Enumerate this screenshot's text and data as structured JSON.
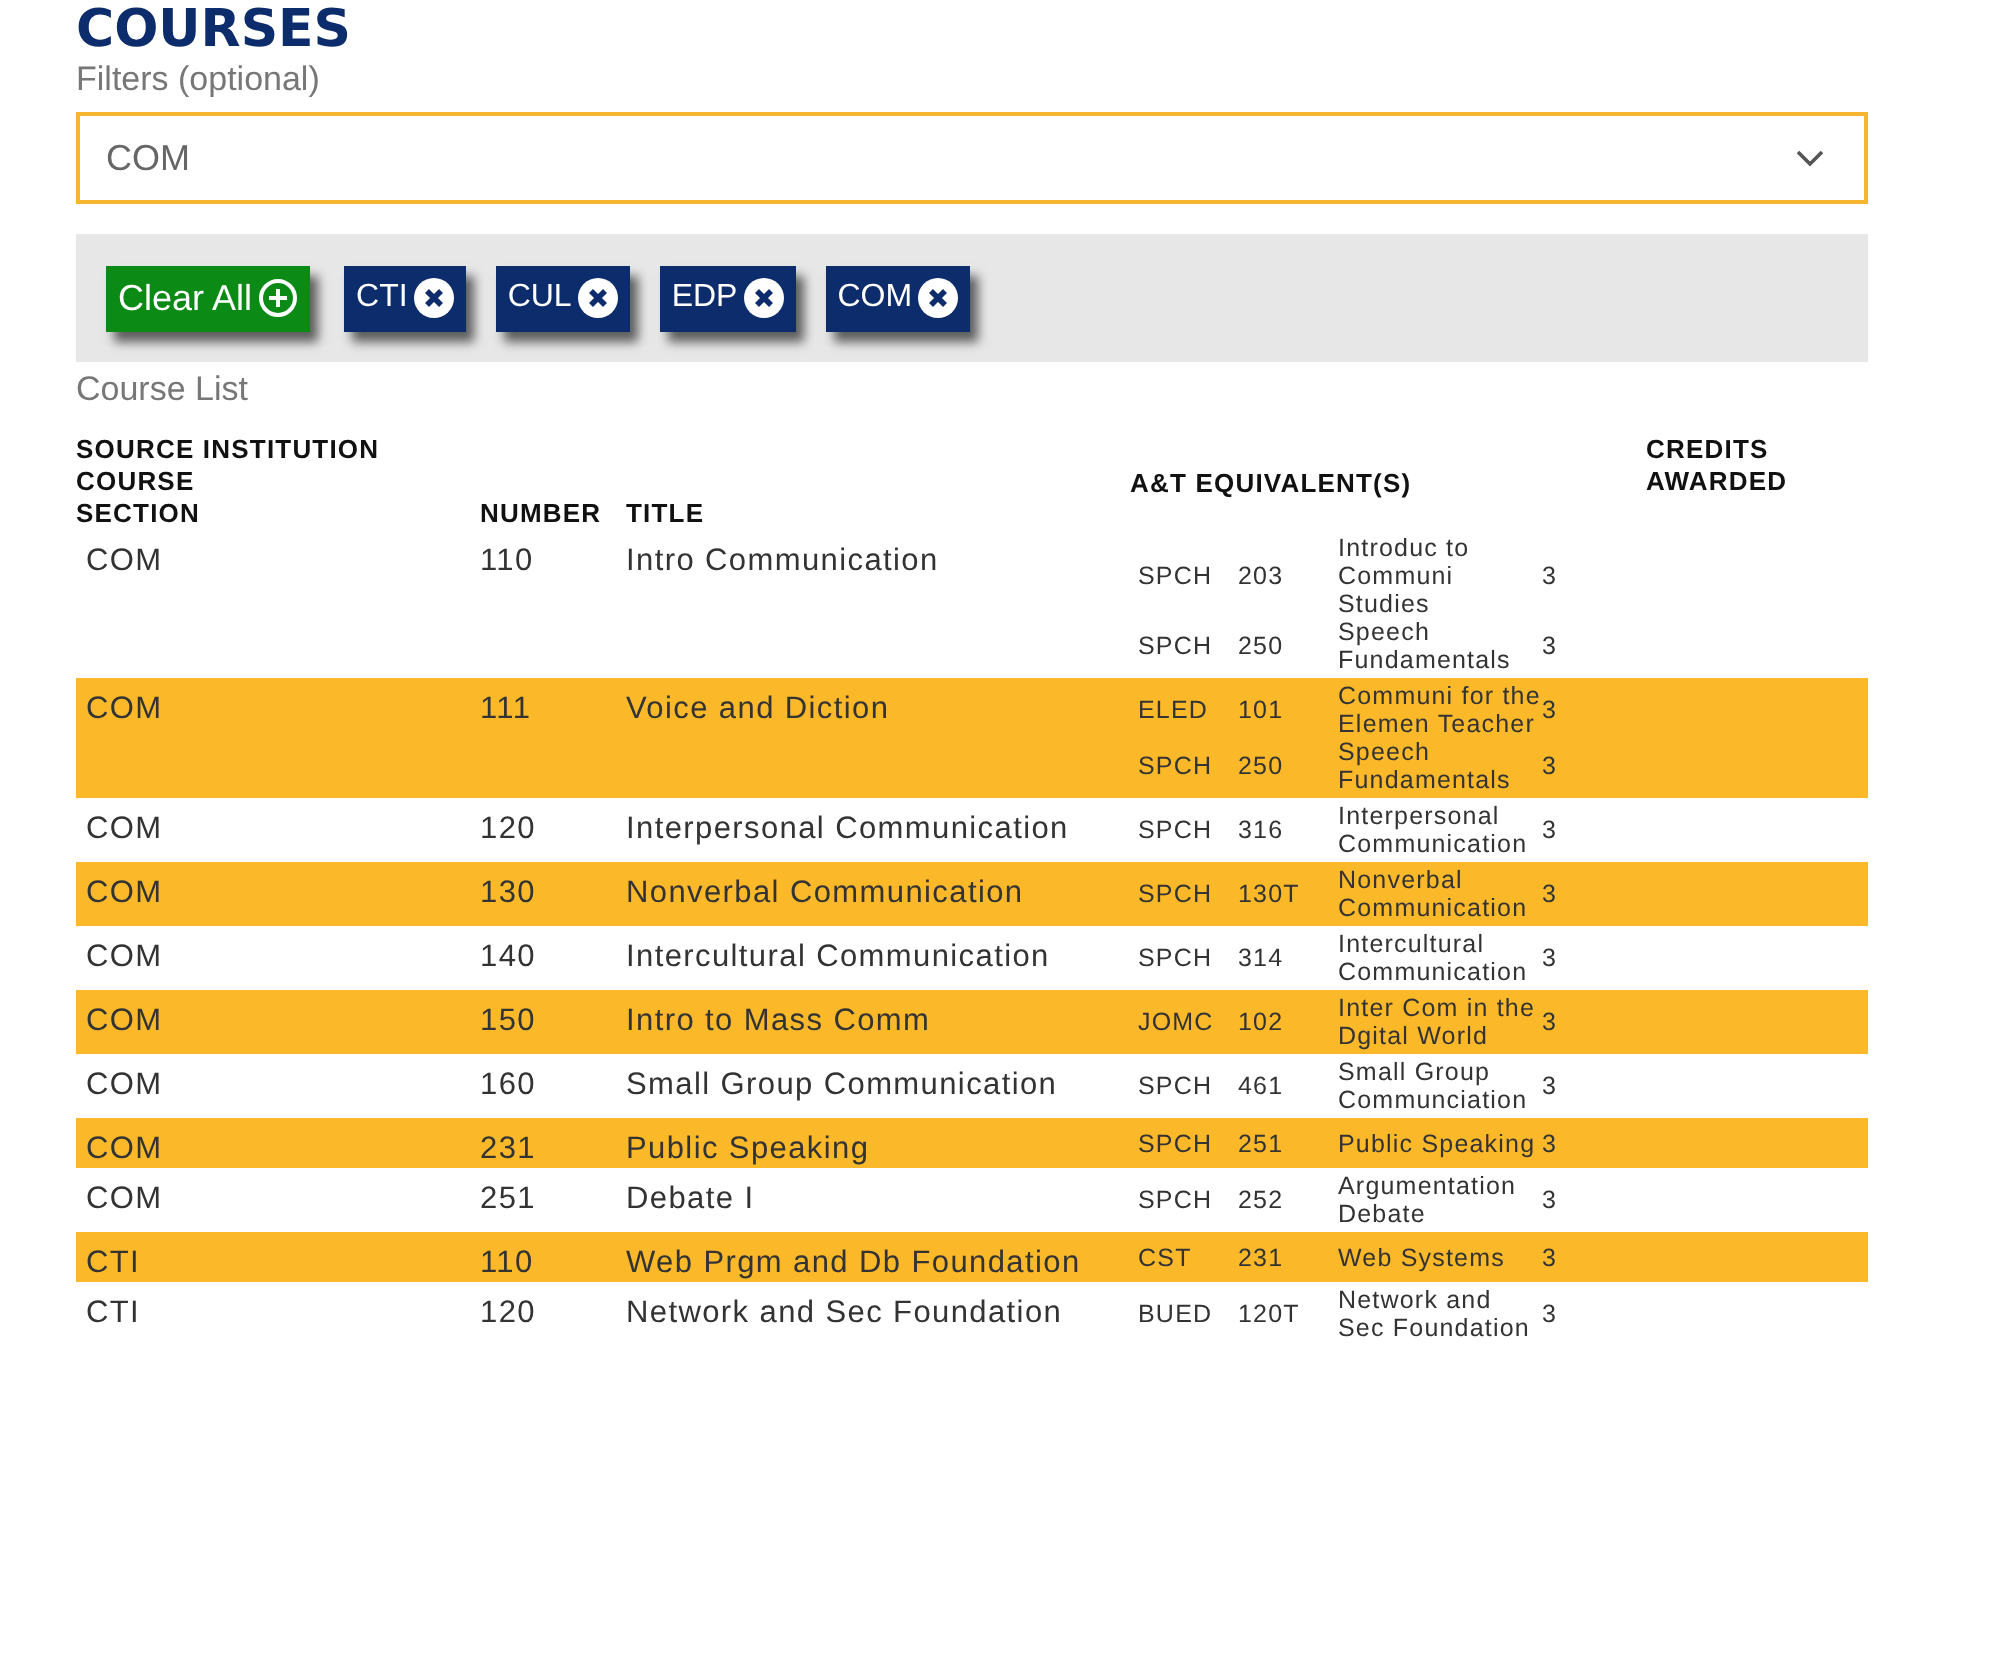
{
  "heading": "COURSES",
  "filters": {
    "label": "Filters (optional)",
    "value": "COM",
    "clear_all": "Clear All",
    "chips": [
      {
        "label": "CTI"
      },
      {
        "label": "CUL"
      },
      {
        "label": "EDP"
      },
      {
        "label": "COM"
      }
    ]
  },
  "table": {
    "caption": "Course List",
    "columns": {
      "source": [
        "SOURCE INSTITUTION",
        "COURSE",
        "SECTION"
      ],
      "number": "NUMBER",
      "title": "TITLE",
      "equivalents": "A&T EQUIVALENT(S)",
      "credits": [
        "CREDITS",
        "AWARDED"
      ]
    },
    "rows": [
      {
        "section": "COM",
        "number": "110",
        "title": "Intro Communication",
        "equivalents": [
          {
            "subject": "SPCH",
            "number": "203",
            "title": "Introduc to Communi Studies",
            "credits": "3"
          },
          {
            "subject": "SPCH",
            "number": "250",
            "title": "Speech Fundamentals",
            "credits": "3"
          }
        ]
      },
      {
        "section": "COM",
        "number": "111",
        "title": "Voice and Diction",
        "equivalents": [
          {
            "subject": "ELED",
            "number": "101",
            "title": "Communi for the Elemen Teacher",
            "credits": "3"
          },
          {
            "subject": "SPCH",
            "number": "250",
            "title": "Speech Fundamentals",
            "credits": "3"
          }
        ]
      },
      {
        "section": "COM",
        "number": "120",
        "title": "Interpersonal Communication",
        "equivalents": [
          {
            "subject": "SPCH",
            "number": "316",
            "title": "Interpersonal Communication",
            "credits": "3"
          }
        ]
      },
      {
        "section": "COM",
        "number": "130",
        "title": "Nonverbal Communication",
        "equivalents": [
          {
            "subject": "SPCH",
            "number": "130T",
            "title": "Nonverbal Communication",
            "credits": "3"
          }
        ]
      },
      {
        "section": "COM",
        "number": "140",
        "title": "Intercultural Communication",
        "equivalents": [
          {
            "subject": "SPCH",
            "number": "314",
            "title": "Intercultural Communication",
            "credits": "3"
          }
        ]
      },
      {
        "section": "COM",
        "number": "150",
        "title": "Intro to Mass Comm",
        "equivalents": [
          {
            "subject": "JOMC",
            "number": "102",
            "title": "Inter Com in the Dgital World",
            "credits": "3"
          }
        ]
      },
      {
        "section": "COM",
        "number": "160",
        "title": "Small Group Communication",
        "equivalents": [
          {
            "subject": "SPCH",
            "number": "461",
            "title": "Small Group Communciation",
            "credits": "3"
          }
        ]
      },
      {
        "section": "COM",
        "number": "231",
        "title": "Public Speaking",
        "equivalents": [
          {
            "subject": "SPCH",
            "number": "251",
            "title": "Public Speaking",
            "credits": "3"
          }
        ]
      },
      {
        "section": "COM",
        "number": "251",
        "title": "Debate I",
        "equivalents": [
          {
            "subject": "SPCH",
            "number": "252",
            "title": "Argumentation Debate",
            "credits": "3"
          }
        ]
      },
      {
        "section": "CTI",
        "number": "110",
        "title": "Web Prgm and Db Foundation",
        "equivalents": [
          {
            "subject": "CST",
            "number": "231",
            "title": "Web Systems",
            "credits": "3"
          }
        ]
      },
      {
        "section": "CTI",
        "number": "120",
        "title": "Network and Sec Foundation",
        "equivalents": [
          {
            "subject": "BUED",
            "number": "120T",
            "title": "Network and Sec Foundation",
            "credits": "3"
          }
        ]
      }
    ]
  }
}
